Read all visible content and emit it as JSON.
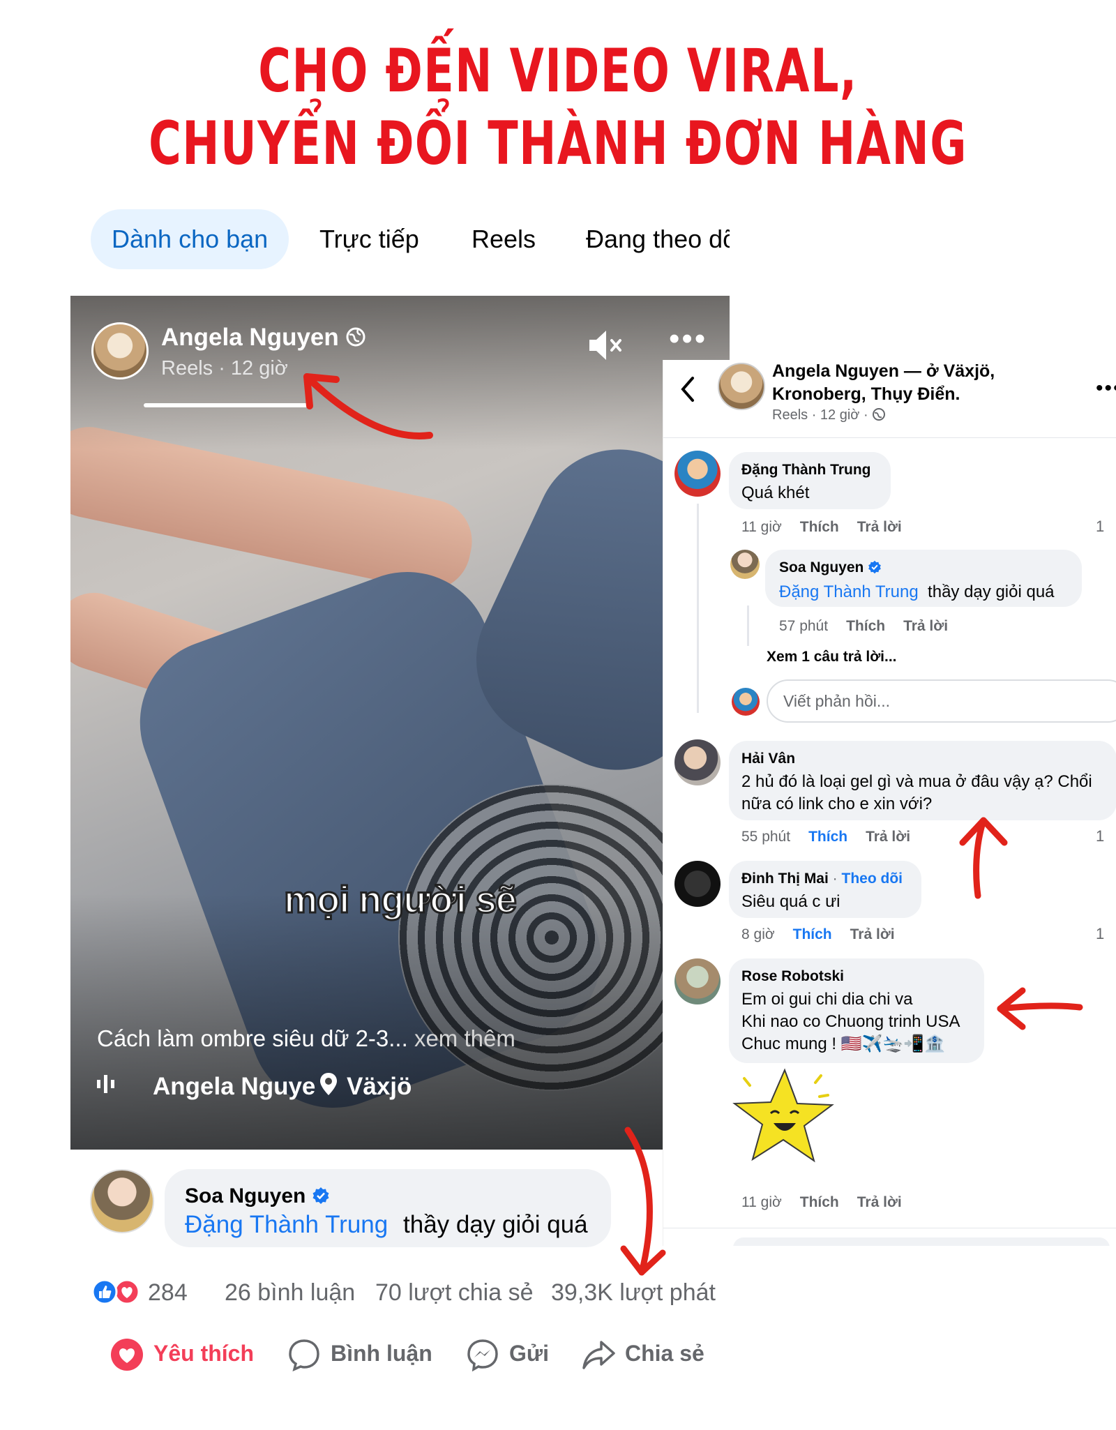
{
  "headline": {
    "line1": "CHO ĐẾN VIDEO VIRAL,",
    "line2": "CHUYỂN ĐỔI THÀNH ĐƠN HÀNG",
    "color": "#e8161f"
  },
  "tabs": [
    {
      "label": "Dành cho bạn",
      "active": true
    },
    {
      "label": "Trực tiếp"
    },
    {
      "label": "Reels"
    },
    {
      "label": "Đang theo dõ"
    }
  ],
  "video": {
    "author": "Angela Nguyen",
    "meta": "Reels · 12 giờ",
    "caption_overlay": "mọi người sẽ",
    "description": "Cách làm ombre siêu dữ 2-3...",
    "see_more": "xem thêm",
    "footer_author": "Angela Nguye",
    "location": "Växjö",
    "icons": [
      "globe-icon",
      "mute-icon",
      "more-icon",
      "audio-icon",
      "location-pin-icon"
    ]
  },
  "featured_comment": {
    "name": "Soa Nguyen",
    "tag": "Đặng Thành Trung",
    "text": "thầy dạy giỏi quá"
  },
  "stats": {
    "reactions": "284",
    "comments": "26 bình luận",
    "shares": "70 lượt chia sẻ",
    "plays": "39,3K lượt phát"
  },
  "actions": {
    "like": "Yêu thích",
    "comment": "Bình luận",
    "send": "Gửi",
    "share": "Chia sẻ"
  },
  "panel": {
    "title": "Angela Nguyen — ở Växjö, Kronoberg, Thụy Điển.",
    "title_line1": "Angela Nguyen — ở Växjö,",
    "title_line2": "Kronoberg, Thụy Điển.",
    "meta": "Reels · 12 giờ ·",
    "reply_placeholder": "Viết phản hồi...",
    "view_replies": "Xem 1 câu trả lời...",
    "comments": [
      {
        "name": "Đặng Thành Trung",
        "text": "Quá khét",
        "time": "11 giờ",
        "like": "Thích",
        "reply": "Trả lời",
        "count": "1"
      },
      {
        "name": "Soa Nguyen",
        "tag": "Đặng Thành Trung",
        "text": "thầy dạy giỏi quá",
        "time": "57 phút",
        "like": "Thích",
        "reply": "Trả lời"
      },
      {
        "name": "Hải Vân",
        "text1": "2 hủ đó là loại gel gì và mua ở đâu vậy ạ? Chổi",
        "text2": "nữa có link cho e xin với?",
        "time": "55 phút",
        "like": "Thích",
        "reply": "Trả lời",
        "count": "1"
      },
      {
        "name": "Đinh Thị Mai",
        "follow": "Theo dõi",
        "text": "Siêu quá c ưi",
        "time": "8 giờ",
        "like": "Thích",
        "reply": "Trả lời",
        "count": "1"
      },
      {
        "name": "Rose Robotski",
        "text1": "Em oi gui chi dia chi va",
        "text2": "Khi nao co Chuong trinh USA",
        "text3": "Chuc mung ! 🇺🇸✈️🛬📲🏦",
        "time": "11 giờ",
        "like": "Thích",
        "reply": "Trả lời"
      }
    ]
  },
  "colors": {
    "facebook_blue": "#1877f2",
    "love_red": "#f33e58",
    "arrow_red": "#e1231a"
  }
}
